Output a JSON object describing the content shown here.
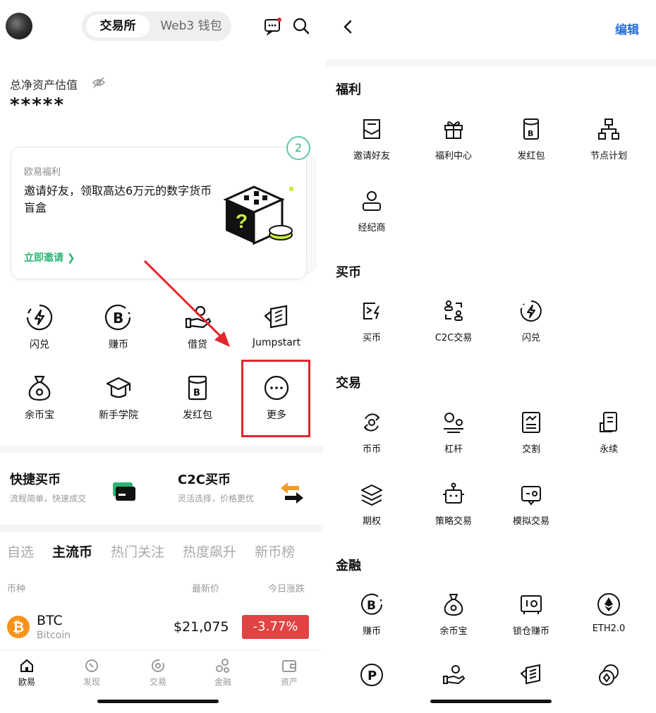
{
  "left": {
    "header": {
      "seg_active": "交易所",
      "seg_inactive": "Web3 钱包"
    },
    "assets": {
      "label": "总净资产估值",
      "value": "*****"
    },
    "promo": {
      "tag": "欧易福利",
      "headline": "邀请好友，领取高达6万元的数字货币盲盒",
      "cta": "立即邀请 ❯",
      "badge": "2"
    },
    "features": [
      {
        "label": "闪兑",
        "icon": "flash-icon"
      },
      {
        "label": "赚币",
        "icon": "bitcoin-icon"
      },
      {
        "label": "借贷",
        "icon": "loan-icon"
      },
      {
        "label": "Jumpstart",
        "icon": "jumpstart-icon"
      },
      {
        "label": "余币宝",
        "icon": "moneybag-icon"
      },
      {
        "label": "新手学院",
        "icon": "graduation-icon"
      },
      {
        "label": "发红包",
        "icon": "redpacket-icon"
      },
      {
        "label": "更多",
        "icon": "more-icon"
      }
    ],
    "quick": [
      {
        "title": "快捷买币",
        "sub": "流程简单，快速成交"
      },
      {
        "title": "C2C买币",
        "sub": "灵活选择，价格更优"
      }
    ],
    "tabs": [
      "自选",
      "主流币",
      "热门关注",
      "热度飙升",
      "新币榜"
    ],
    "columns": {
      "coin": "币种",
      "price": "最新价",
      "change": "今日涨跌"
    },
    "row": {
      "icon": "₿",
      "symbol": "BTC",
      "name": "Bitcoin",
      "price": "$21,075",
      "change": "-3.77%"
    },
    "nav": [
      "欧易",
      "发现",
      "交易",
      "金融",
      "资产"
    ]
  },
  "right": {
    "edit": "编辑",
    "sections": [
      {
        "title": "福利",
        "items": [
          "邀请好友",
          "福利中心",
          "发红包",
          "节点计划",
          "经纪商"
        ]
      },
      {
        "title": "买币",
        "items": [
          "买币",
          "C2C交易",
          "闪兑"
        ]
      },
      {
        "title": "交易",
        "items": [
          "币币",
          "杠杆",
          "交割",
          "永续",
          "期权",
          "策略交易",
          "模拟交易"
        ]
      },
      {
        "title": "金融",
        "items": [
          "赚币",
          "余币宝",
          "锁仓赚币",
          "ETH2.0"
        ]
      }
    ]
  },
  "colors": {
    "accent_green": "#2bb673",
    "highlight_red": "#e1262c",
    "down_red": "#e04444",
    "link_blue": "#2a6fd6"
  }
}
